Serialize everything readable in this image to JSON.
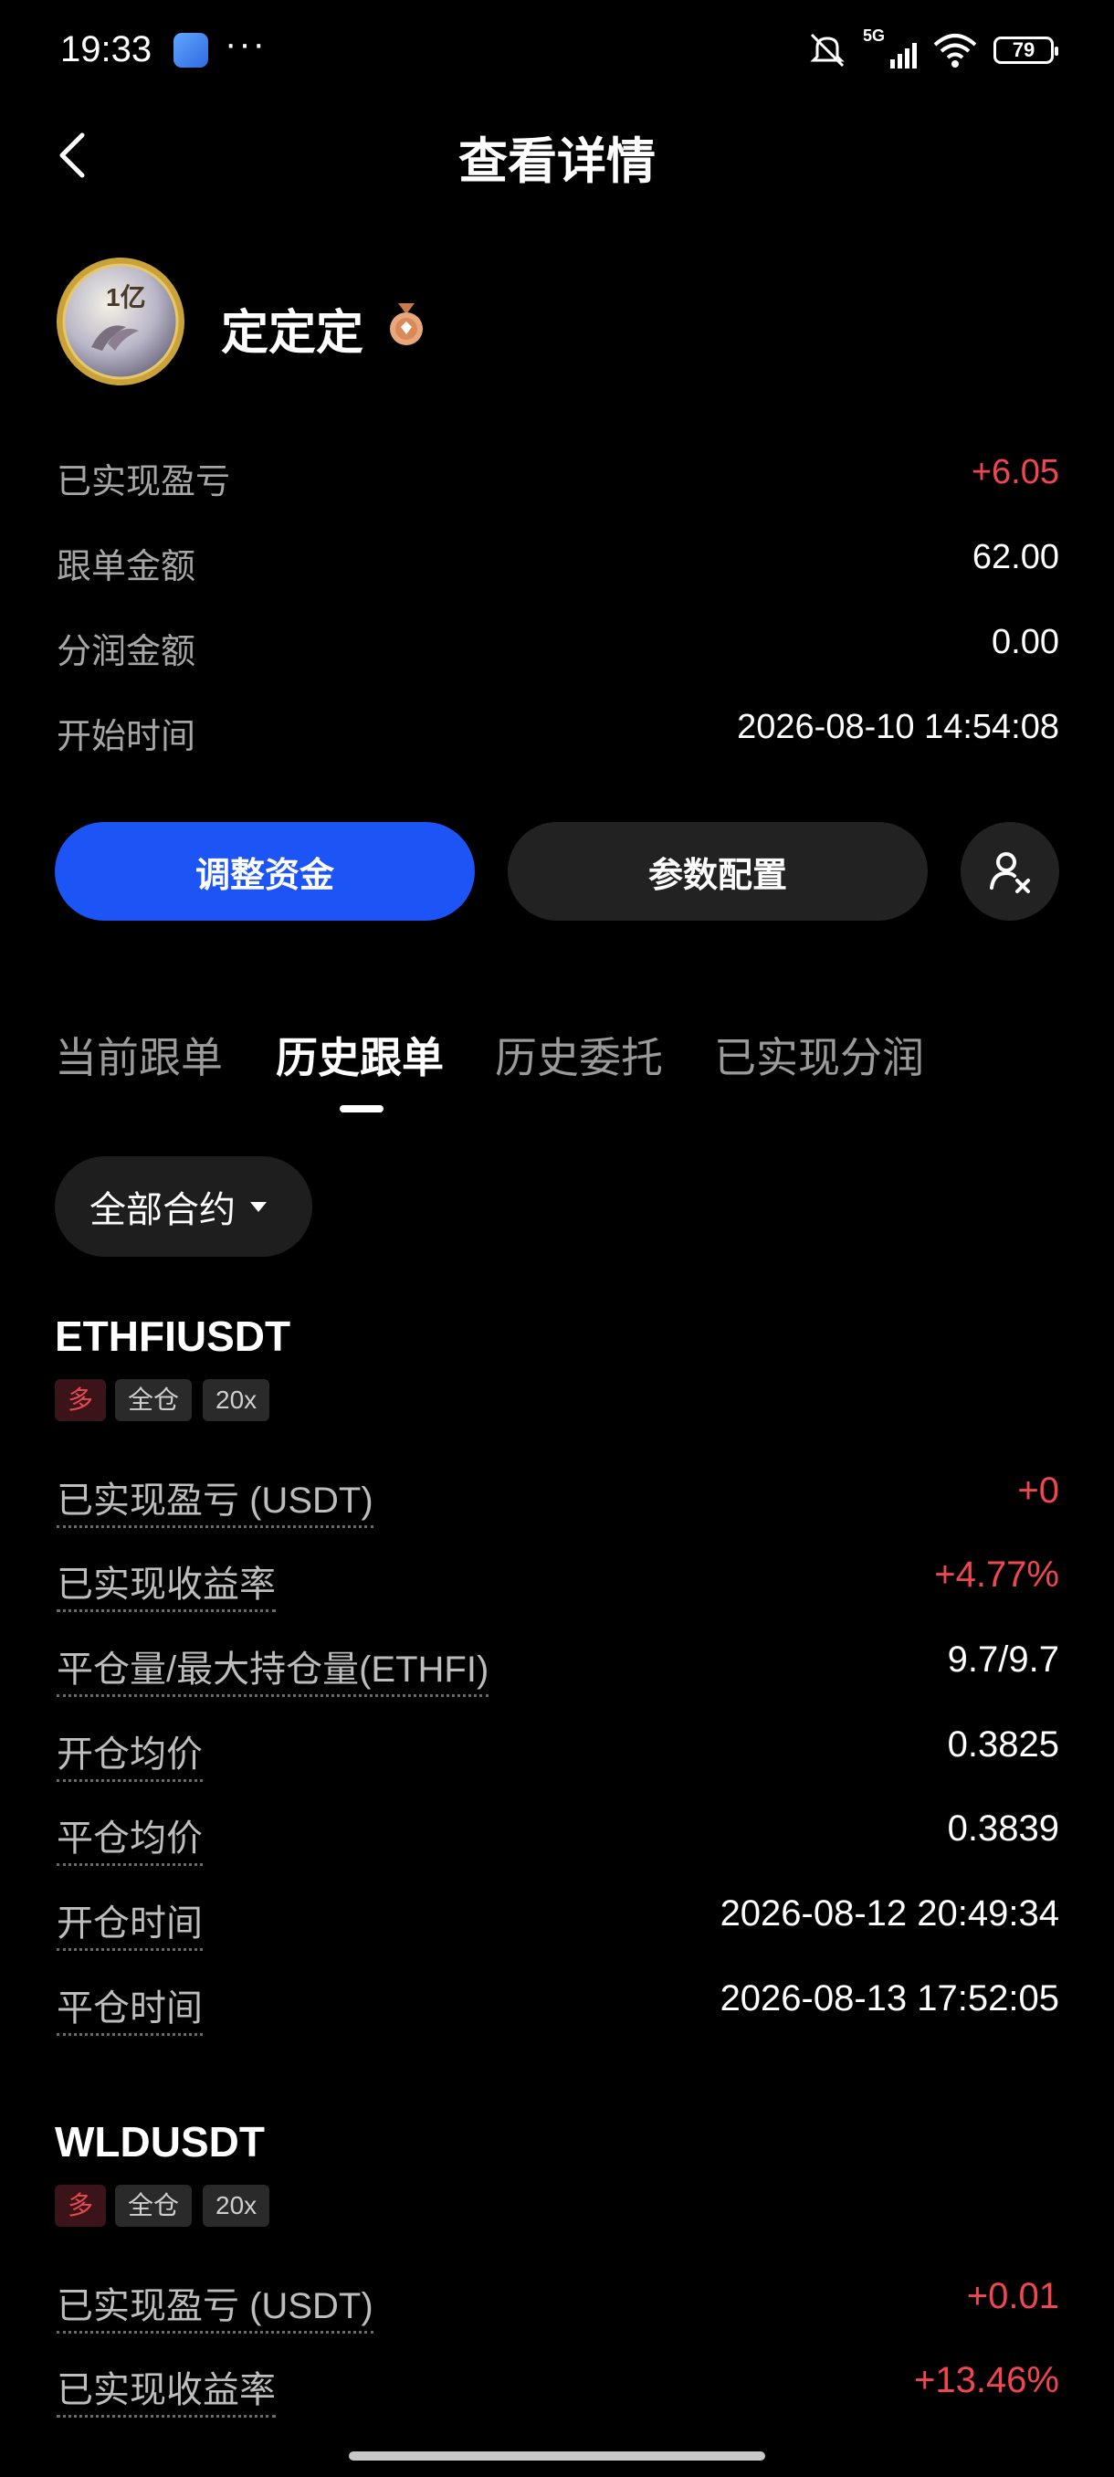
{
  "status_bar": {
    "time": "19:33",
    "dots": "···",
    "network": "5G",
    "battery": "79"
  },
  "header": {
    "title": "查看详情"
  },
  "profile": {
    "name": "定定定",
    "avatar_text": "1亿"
  },
  "stats": [
    {
      "label": "已实现盈亏",
      "value": "+6.05"
    },
    {
      "label": "跟单金额",
      "value": "62.00"
    },
    {
      "label": "分润金额",
      "value": "0.00"
    },
    {
      "label": "开始时间",
      "value": "2026-08-10 14:54:08"
    }
  ],
  "actions": {
    "adjust_funds": "调整资金",
    "param_config": "参数配置"
  },
  "tabs": [
    {
      "label": "当前跟单"
    },
    {
      "label": "历史跟单"
    },
    {
      "label": "历史委托"
    },
    {
      "label": "已实现分润"
    }
  ],
  "filter": {
    "label": "全部合约"
  },
  "orders": [
    {
      "symbol": "ETHFIUSDT",
      "tags": [
        "多",
        "全仓",
        "20x"
      ],
      "rows": [
        {
          "label": "已实现盈亏 (USDT)",
          "value": "+0"
        },
        {
          "label": "已实现收益率",
          "value": "+4.77%"
        },
        {
          "label": "平仓量/最大持仓量(ETHFI)",
          "value": "9.7/9.7"
        },
        {
          "label": "开仓均价",
          "value": "0.3825"
        },
        {
          "label": "平仓均价",
          "value": "0.3839"
        },
        {
          "label": "开仓时间",
          "value": "2026-08-12 20:49:34"
        },
        {
          "label": "平仓时间",
          "value": "2026-08-13 17:52:05"
        }
      ]
    },
    {
      "symbol": "WLDUSDT",
      "tags": [
        "多",
        "全仓",
        "20x"
      ],
      "rows": [
        {
          "label": "已实现盈亏 (USDT)",
          "value": "+0.01"
        },
        {
          "label": "已实现收益率",
          "value": "+13.46%"
        }
      ]
    }
  ],
  "colors": {
    "background": "#000000",
    "accent_blue": "#1c54f5",
    "profit_red": "#f0464f"
  }
}
